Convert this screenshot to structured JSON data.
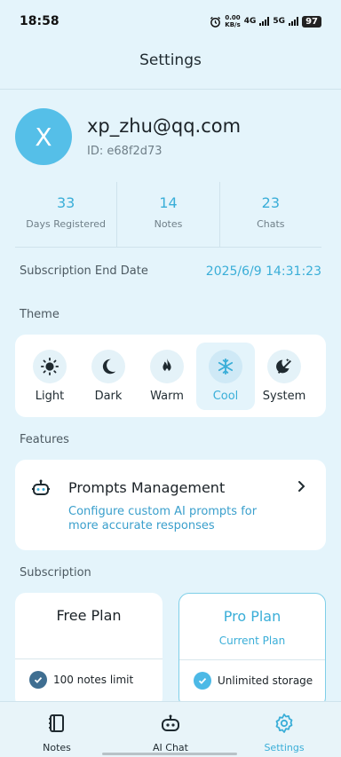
{
  "status_bar": {
    "time": "18:58",
    "net_speed": "0.00",
    "net_unit": "KB/s",
    "lte1": "4G",
    "lte2": "5G",
    "battery": "97"
  },
  "header": {
    "title": "Settings"
  },
  "profile": {
    "avatar_letter": "X",
    "email": "xp_zhu@qq.com",
    "id": "ID: e68f2d73"
  },
  "stats": [
    {
      "value": "33",
      "label": "Days Registered"
    },
    {
      "value": "14",
      "label": "Notes"
    },
    {
      "value": "23",
      "label": "Chats"
    }
  ],
  "subscription_end": {
    "label": "Subscription End Date",
    "value": "2025/6/9 14:31:23"
  },
  "theme": {
    "section_title": "Theme",
    "options": [
      {
        "label": "Light",
        "icon": "sun-icon"
      },
      {
        "label": "Dark",
        "icon": "moon-icon"
      },
      {
        "label": "Warm",
        "icon": "flame-icon"
      },
      {
        "label": "Cool",
        "icon": "snowflake-icon"
      },
      {
        "label": "System",
        "icon": "auto-theme-icon"
      }
    ],
    "selected": "Cool"
  },
  "features": {
    "section_title": "Features",
    "items": [
      {
        "title": "Prompts Management",
        "description": "Configure custom AI prompts for more accurate responses"
      }
    ]
  },
  "subscription": {
    "section_title": "Subscription",
    "plans": [
      {
        "name": "Free Plan",
        "subtitle": "",
        "feature": "100 notes limit"
      },
      {
        "name": "Pro Plan",
        "subtitle": "Current Plan",
        "feature": "Unlimited storage"
      }
    ]
  },
  "bottom_nav": {
    "items": [
      {
        "label": "Notes",
        "icon": "notebook-icon"
      },
      {
        "label": "AI Chat",
        "icon": "robot-icon"
      },
      {
        "label": "Settings",
        "icon": "gear-icon"
      }
    ],
    "active": "Settings"
  },
  "colors": {
    "accent": "#3aaed8",
    "background": "#e4f4fb",
    "avatar": "#55bfe8"
  }
}
